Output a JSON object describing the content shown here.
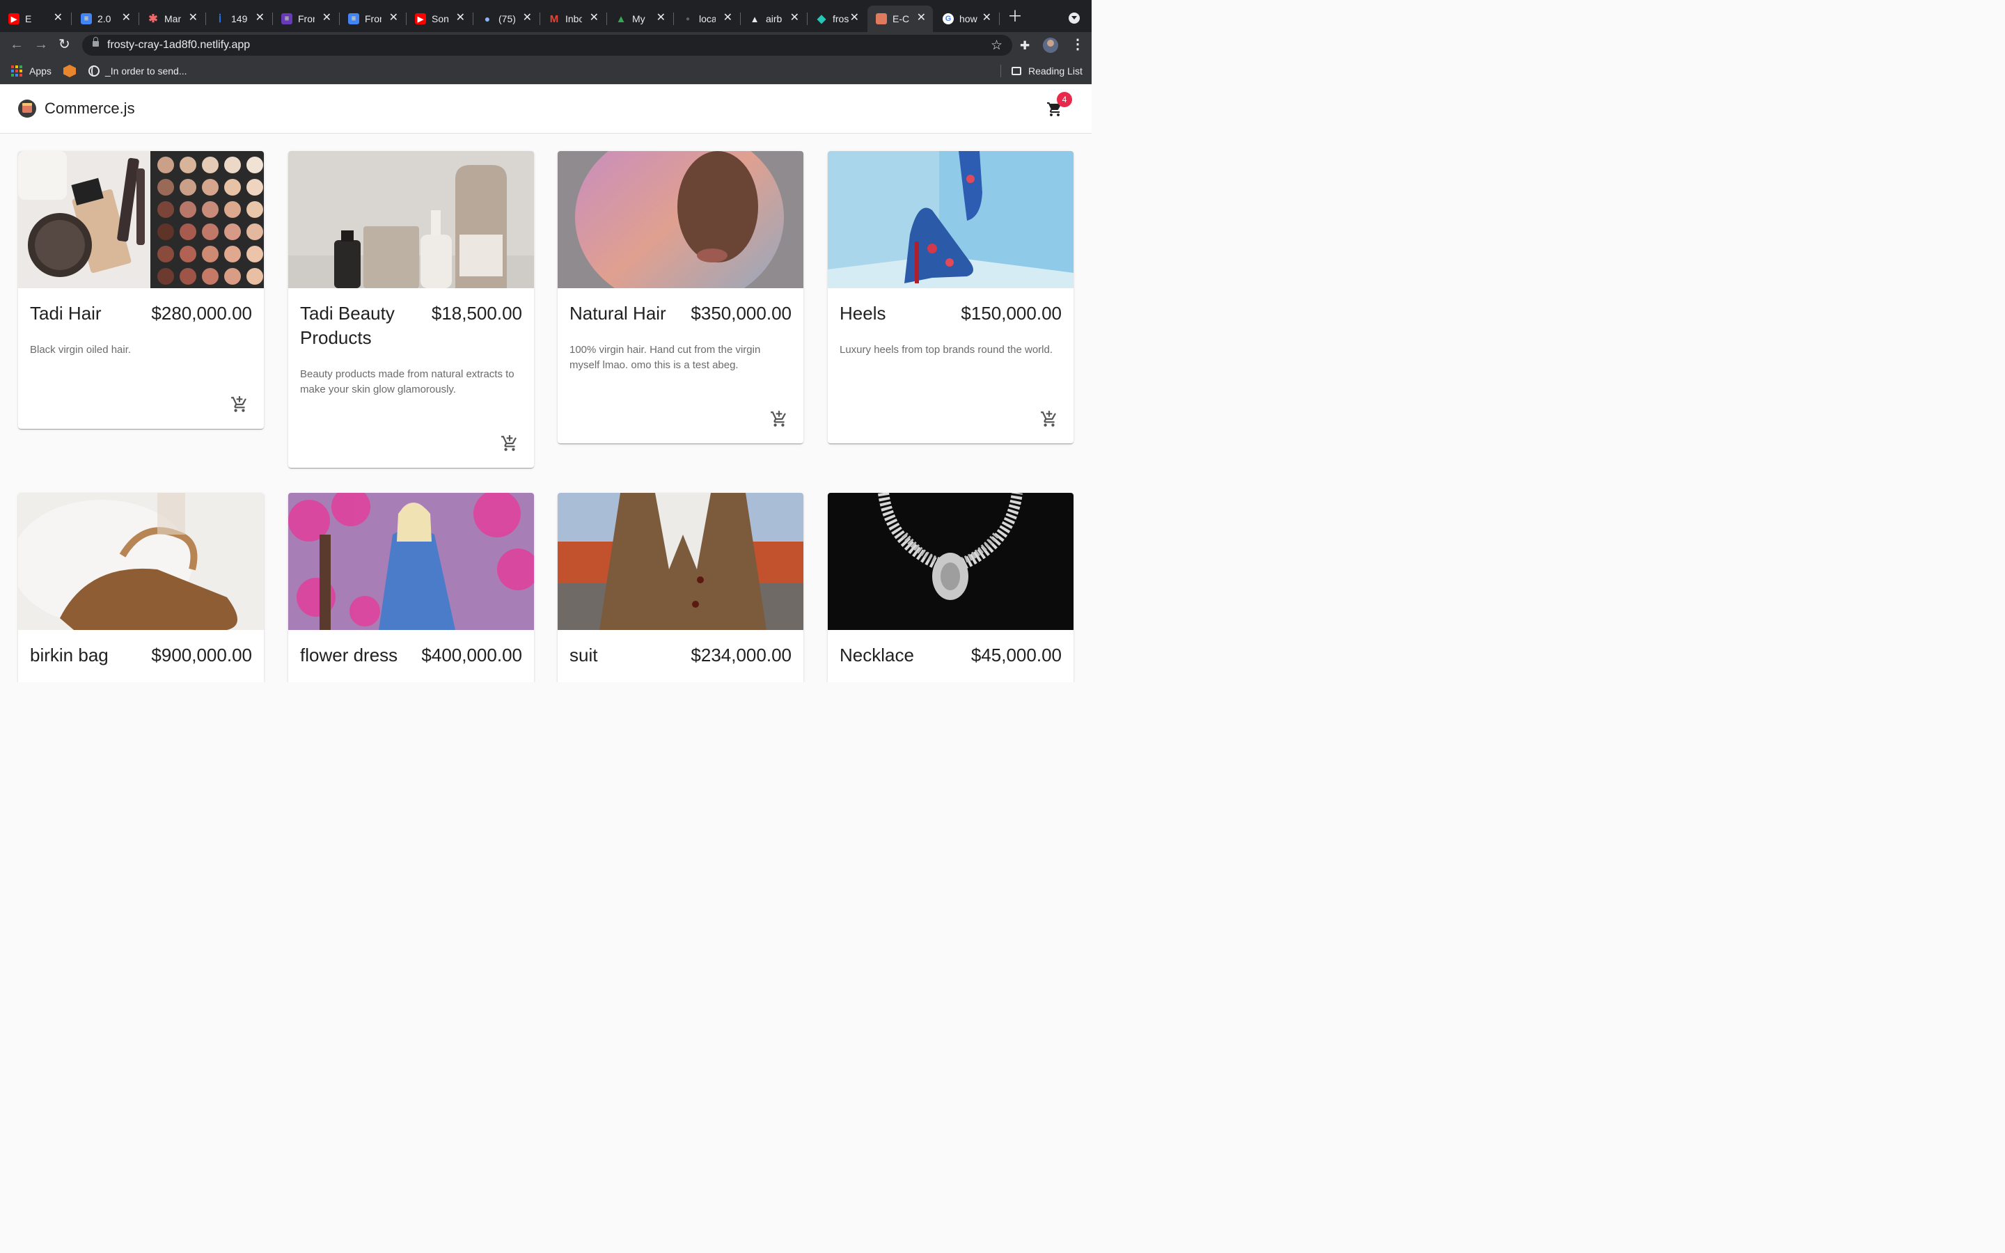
{
  "browser": {
    "tabs": [
      {
        "title": "E",
        "favicon": "youtube-icon",
        "color": "#ff0000"
      },
      {
        "title": "2.0",
        "favicon": "docs-icon",
        "color": "#4285f4"
      },
      {
        "title": "Man",
        "favicon": "asana-icon",
        "color": "#f06a6a"
      },
      {
        "title": "149",
        "favicon": "info-icon",
        "color": "#1a73e8"
      },
      {
        "title": "Fron",
        "favicon": "forms-icon",
        "color": "#673ab7"
      },
      {
        "title": "Fron",
        "favicon": "docs-icon",
        "color": "#4285f4"
      },
      {
        "title": "Son",
        "favicon": "youtube-icon",
        "color": "#ff0000"
      },
      {
        "title": "(75)",
        "favicon": "dot-icon",
        "color": "#8ab4f8"
      },
      {
        "title": "Inbo",
        "favicon": "gmail-icon",
        "color": "#ea4335"
      },
      {
        "title": "My",
        "favicon": "drive-icon",
        "color": "#34a853"
      },
      {
        "title": "loca",
        "favicon": "dot-icon",
        "color": "#5f6368"
      },
      {
        "title": "airb",
        "favicon": "triangle-icon",
        "color": "#e8eaed"
      },
      {
        "title": "fros",
        "favicon": "netlify-icon",
        "color": "#25c7b7"
      },
      {
        "title": "E-C",
        "favicon": "store-icon",
        "color": "#e07a5f",
        "active": true
      },
      {
        "title": "how",
        "favicon": "google-icon",
        "color": "#4285f4"
      }
    ],
    "url": "frosty-cray-1ad8f0.netlify.app",
    "bookmarks": [
      {
        "label": "Apps"
      },
      {
        "label": ""
      },
      {
        "label": "_In order to send..."
      }
    ],
    "reading_list": "Reading List"
  },
  "app": {
    "brand": "Commerce.js",
    "cart_count": "4"
  },
  "products": [
    {
      "name": "Tadi Hair",
      "price": "$280,000.00",
      "description": "Black virgin oiled hair.",
      "image": "makeup-palette-photo"
    },
    {
      "name": "Tadi Beauty Products",
      "price": "$18,500.00",
      "description": "Beauty products made from natural extracts to make your skin glow glamorously.",
      "image": "skincare-bottles-photo"
    },
    {
      "name": "Natural Hair",
      "price": "$350,000.00",
      "description": "100% virgin hair. Hand cut from the virgin myself lmao. omo this is a test abeg.",
      "image": "curly-hair-portrait-photo"
    },
    {
      "name": "Heels",
      "price": "$150,000.00",
      "description": "Luxury heels from top brands round the world.",
      "image": "floral-heels-photo"
    },
    {
      "name": "birkin bag",
      "price": "$900,000.00",
      "description": "",
      "image": "leather-bag-photo"
    },
    {
      "name": "flower dress",
      "price": "$400,000.00",
      "description": "",
      "image": "flower-dress-photo"
    },
    {
      "name": "suit",
      "price": "$234,000.00",
      "description": "",
      "image": "plaid-suit-photo"
    },
    {
      "name": "Necklace",
      "price": "$45,000.00",
      "description": "",
      "image": "diamond-necklace-photo"
    }
  ]
}
